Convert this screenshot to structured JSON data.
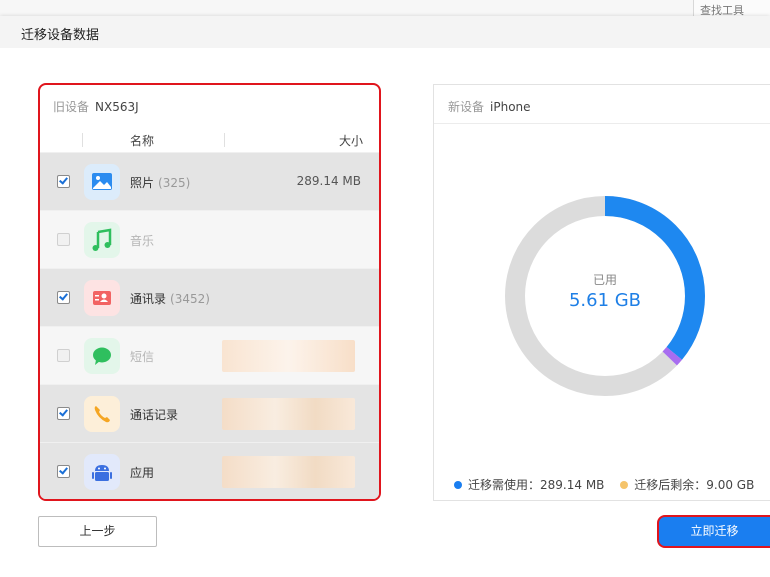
{
  "background": {
    "toolbar_fragment": "查找工具"
  },
  "dialog": {
    "title": "迁移设备数据",
    "old_device": {
      "label": "旧设备",
      "name": "NX563J",
      "columns": {
        "name": "名称",
        "size": "大小"
      },
      "items": [
        {
          "label": "照片",
          "count": "(325)",
          "size": "289.14 MB",
          "checked": true,
          "enabled": true,
          "icon": "photo-icon",
          "color": "#2b8cf0"
        },
        {
          "label": "音乐",
          "count": "",
          "size": "",
          "checked": false,
          "enabled": false,
          "icon": "music-icon",
          "color": "#2fbf5e"
        },
        {
          "label": "通讯录",
          "count": "(3452)",
          "size": "",
          "checked": true,
          "enabled": true,
          "icon": "contacts-icon",
          "color": "#f26363"
        },
        {
          "label": "短信",
          "count": "",
          "size": "",
          "checked": false,
          "enabled": false,
          "icon": "message-icon",
          "color": "#2fbf5e"
        },
        {
          "label": "通话记录",
          "count": "",
          "size": "",
          "checked": true,
          "enabled": true,
          "icon": "phone-icon",
          "color": "#f5a623"
        },
        {
          "label": "应用",
          "count": "",
          "size": "",
          "checked": true,
          "enabled": true,
          "icon": "android-icon",
          "color": "#3b6fe0"
        }
      ]
    },
    "new_device": {
      "label": "新设备",
      "name": "iPhone",
      "usage_label": "已用",
      "usage_value": "5.61 GB",
      "usage_fraction": 0.36,
      "migrate_fraction": 0.012,
      "legend": [
        {
          "label": "迁移需使用：",
          "value": "289.14 MB",
          "color": "#1a7ef0"
        },
        {
          "label": "迁移后剩余：",
          "value": "9.00 GB",
          "color": "#f5c46b"
        }
      ],
      "colors": {
        "used": "#1e88f0",
        "migrate": "#a86df0",
        "free": "#dcdcdc"
      }
    },
    "buttons": {
      "prev": "上一步",
      "migrate": "立即迁移"
    }
  }
}
